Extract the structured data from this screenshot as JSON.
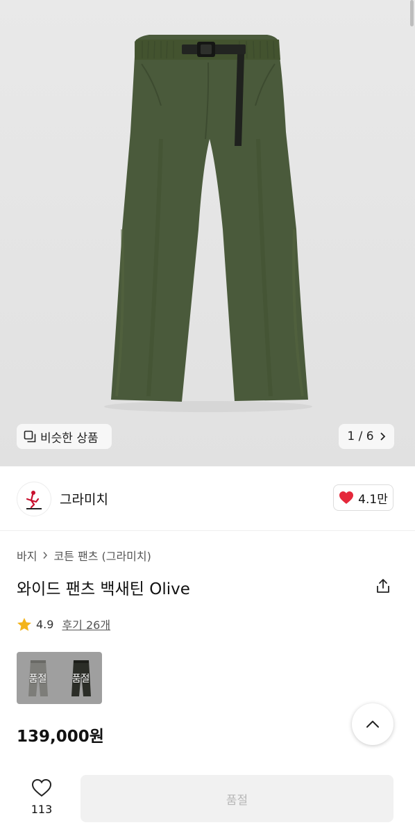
{
  "gallery": {
    "similar_label": "비슷한 상품",
    "pager_label": "1 / 6"
  },
  "brand": {
    "name": "그라미치",
    "likes": "4.1만"
  },
  "breadcrumb": {
    "category": "바지",
    "subcategory": "코튼 팬츠 (그라미치)"
  },
  "product": {
    "title": "와이드 팬츠 백새틴 Olive",
    "rating": "4.9",
    "reviews": "후기 26개",
    "price": "139,000원"
  },
  "options": [
    {
      "label": "품절",
      "color": "#7d7d79"
    },
    {
      "label": "품절",
      "color": "#2b2d27"
    }
  ],
  "bottom_bar": {
    "wish_count": "113",
    "buy_label": "품절"
  },
  "colors": {
    "product_olive": "#4a5a3b",
    "heart_red": "#e5283b",
    "star_gold": "#f3b41b"
  }
}
